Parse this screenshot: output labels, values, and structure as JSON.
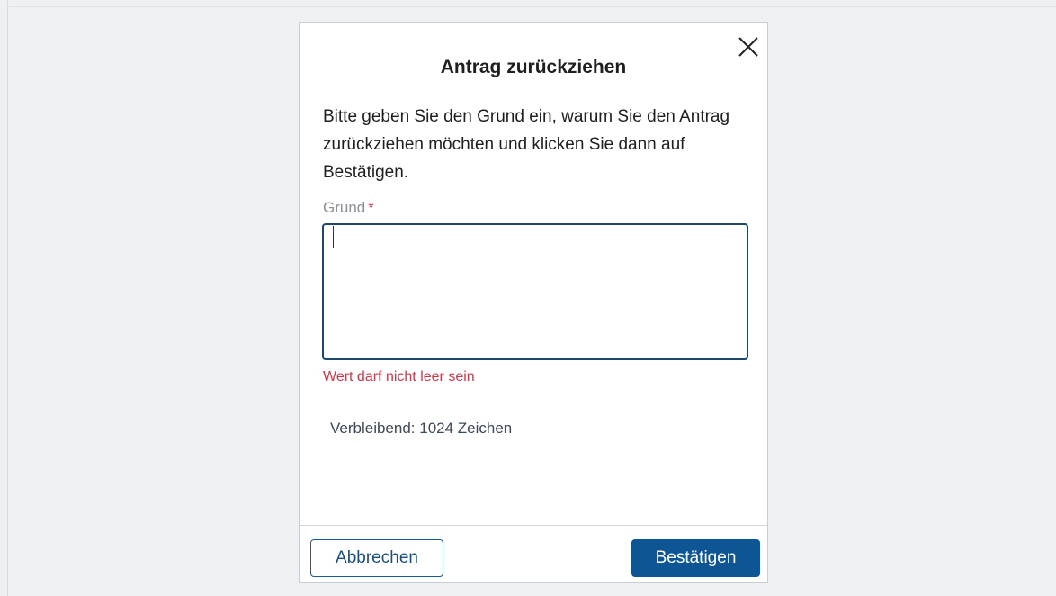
{
  "dialog": {
    "title": "Antrag zurückziehen",
    "close_icon": "close-icon",
    "intro": "Bitte geben Sie den Grund ein, warum Sie den Antrag zurückziehen möchten und klicken Sie dann auf Bestätigen.",
    "field": {
      "label": "Grund",
      "required_marker": "*",
      "value": "",
      "error": "Wert darf nicht leer sein",
      "remaining": "Verbleibend: 1024 Zeichen"
    },
    "buttons": {
      "cancel": "Abbrechen",
      "confirm": "Bestätigen"
    },
    "colors": {
      "primary": "#0e5693",
      "error": "#d0364a",
      "input_border": "#1e4770"
    }
  }
}
